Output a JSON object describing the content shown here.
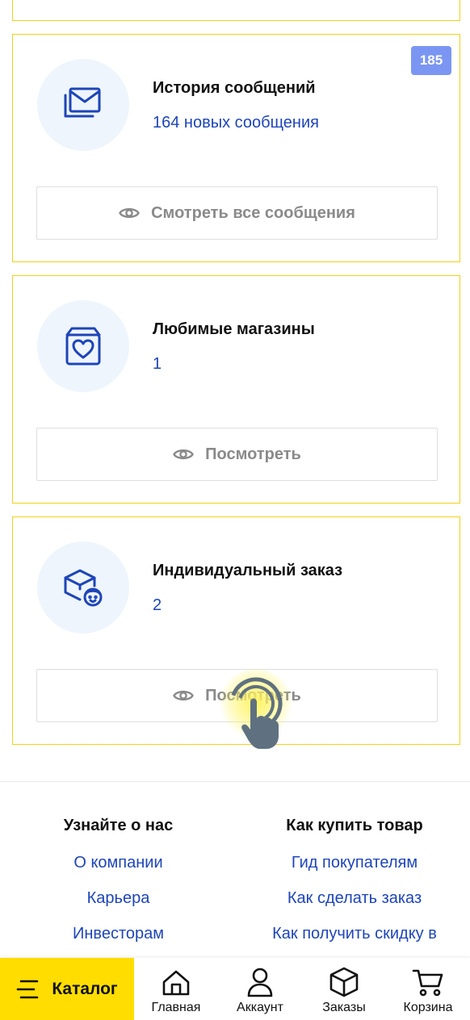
{
  "cards": [
    {
      "title": "История сообщений",
      "subtitle": "164 новых сообщения",
      "badge": "185",
      "icon": "messages-icon",
      "button_label": "Смотреть все сообщения"
    },
    {
      "title": "Любимые магазины",
      "subtitle": "1",
      "icon": "favorite-store-icon",
      "button_label": "Посмотреть"
    },
    {
      "title": "Индивидуальный заказ",
      "subtitle": "2",
      "icon": "custom-order-icon",
      "button_label": "Посмотреть"
    }
  ],
  "footer": {
    "left": {
      "heading": "Узнайте о нас",
      "links": [
        "О компании",
        "Карьера",
        "Инвесторам"
      ]
    },
    "right": {
      "heading": "Как купить товар",
      "links": [
        "Гид покупателям",
        "Как сделать заказ",
        "Как получить скидку в"
      ]
    }
  },
  "bottom_nav": {
    "catalog": "Каталог",
    "items": [
      {
        "label": "Главная",
        "icon": "home-icon"
      },
      {
        "label": "Аккаунт",
        "icon": "user-icon"
      },
      {
        "label": "Заказы",
        "icon": "box-icon"
      },
      {
        "label": "Корзина",
        "icon": "cart-icon"
      }
    ]
  },
  "colors": {
    "accent_yellow": "#ffdd00",
    "link_blue": "#1e45b8",
    "badge_blue": "#7b96f2",
    "card_border": "#f2d21a"
  }
}
